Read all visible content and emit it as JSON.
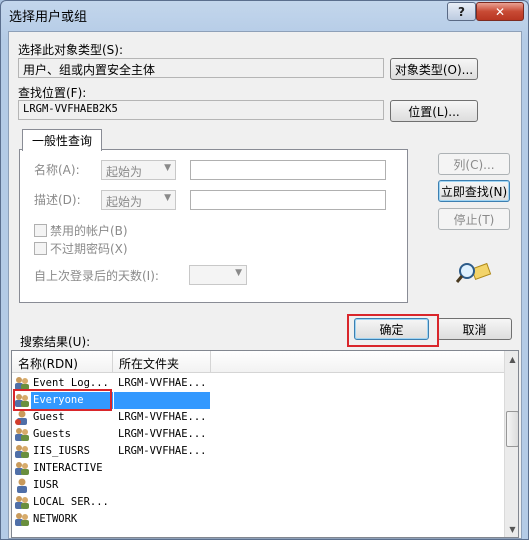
{
  "window": {
    "title": "选择用户或组",
    "help_label": "?",
    "close_label": "✕"
  },
  "object_type": {
    "label": "选择此对象类型(S):",
    "value": "用户、组或内置安全主体",
    "button": "对象类型(O)..."
  },
  "location": {
    "label": "查找位置(F):",
    "value": "LRGM-VVFHAEB2K5",
    "button": "位置(L)..."
  },
  "tab": {
    "label": "一般性查询"
  },
  "query": {
    "name_label": "名称(A):",
    "name_mode": "起始为",
    "desc_label": "描述(D):",
    "desc_mode": "起始为",
    "disabled_accounts": "禁用的帐户(B)",
    "no_expire_password": "不过期密码(X)",
    "days_since_login_label": "自上次登录后的天数(I):"
  },
  "side_buttons": {
    "columns": "列(C)...",
    "find_now": "立即查找(N)",
    "stop": "停止(T)"
  },
  "dialog_buttons": {
    "ok": "确定",
    "cancel": "取消"
  },
  "results": {
    "label": "搜索结果(U):",
    "columns": [
      "名称(RDN)",
      "所在文件夹"
    ],
    "rows": [
      {
        "name": "Event Log...",
        "folder": "LRGM-VVFHAE..."
      },
      {
        "name": "Everyone",
        "folder": ""
      },
      {
        "name": "Guest",
        "folder": "LRGM-VVFHAE..."
      },
      {
        "name": "Guests",
        "folder": "LRGM-VVFHAE..."
      },
      {
        "name": "IIS_IUSRS",
        "folder": "LRGM-VVFHAE..."
      },
      {
        "name": "INTERACTIVE",
        "folder": ""
      },
      {
        "name": "IUSR",
        "folder": ""
      },
      {
        "name": "LOCAL SER...",
        "folder": ""
      },
      {
        "name": "NETWORK",
        "folder": ""
      }
    ],
    "selected_row": "Everyone"
  },
  "colors": {
    "highlight": "#d9262b",
    "selection": "#3399ff"
  }
}
